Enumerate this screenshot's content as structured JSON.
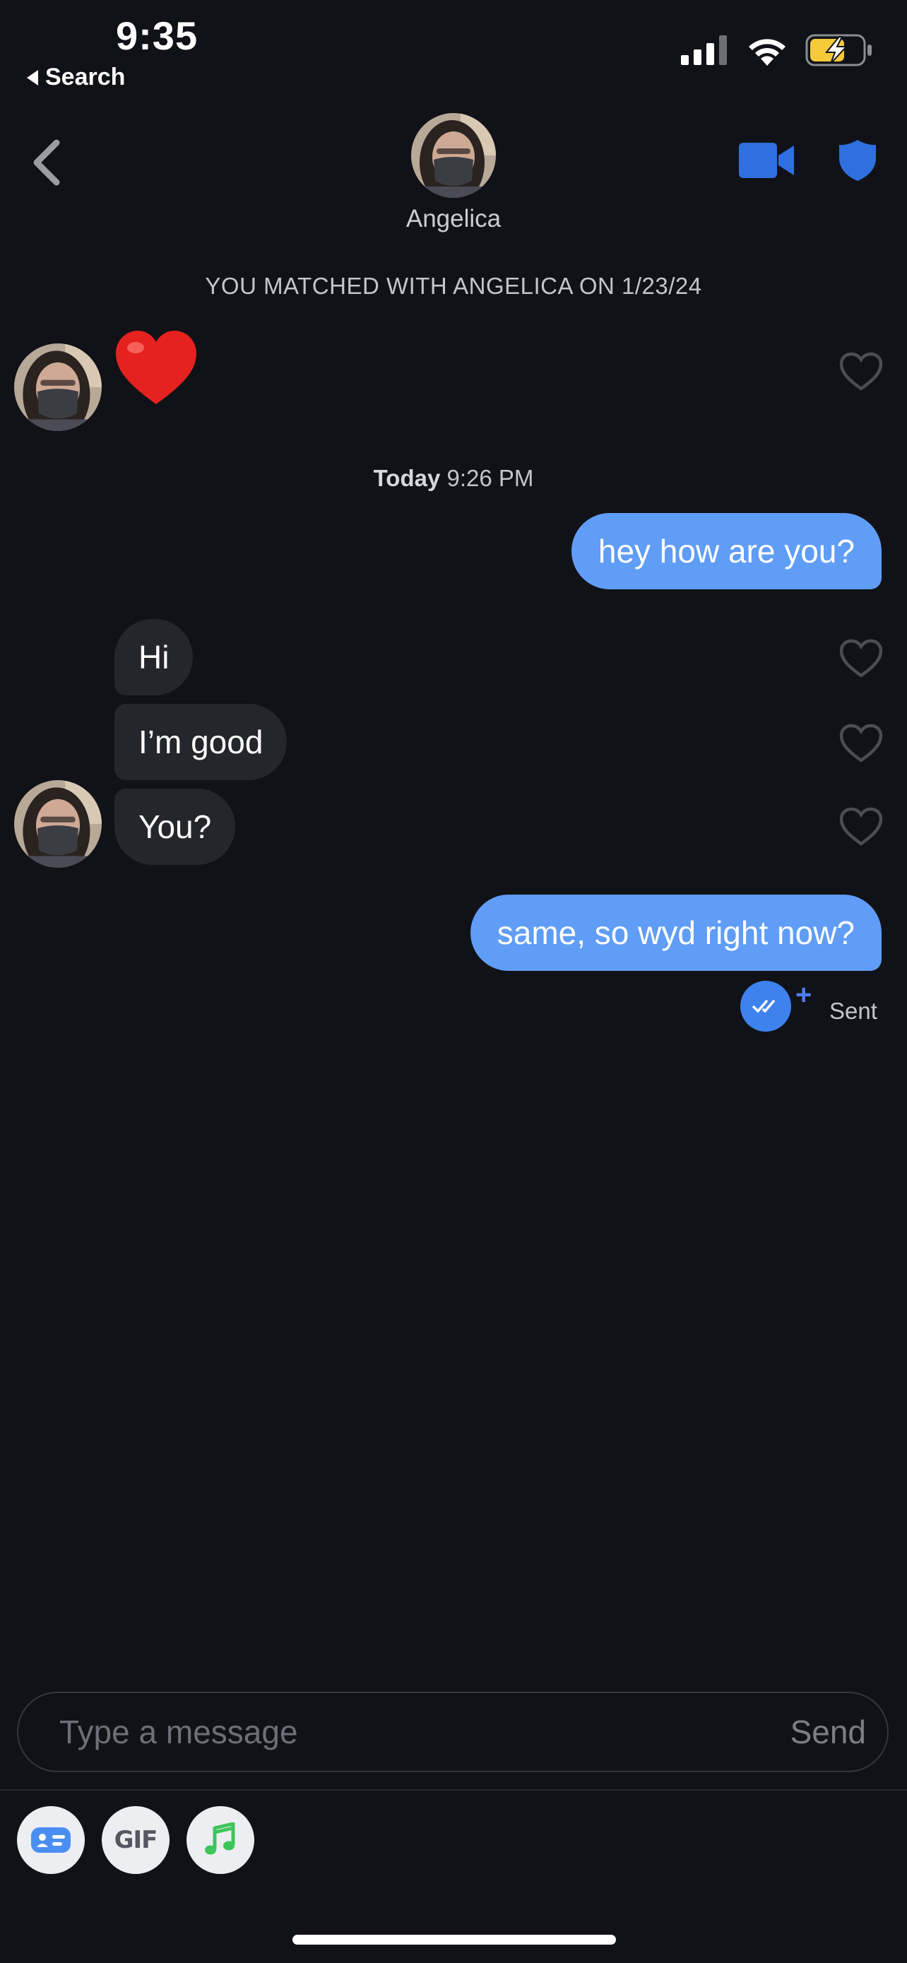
{
  "status_bar": {
    "time": "9:35",
    "back_app_label": "Search",
    "icons": [
      "cellular-signal-icon",
      "wifi-icon",
      "battery-charging-icon"
    ]
  },
  "header": {
    "match_name": "Angelica",
    "icons": [
      "chevron-left-icon",
      "video-camera-icon",
      "shield-icon"
    ]
  },
  "match_notice": "YOU MATCHED WITH ANGELICA ON 1/23/24",
  "thread": {
    "first_message_emoji": "❤️",
    "timestamp_day": "Today",
    "timestamp_time": " 9:26 PM",
    "messages": [
      {
        "from": "me",
        "text": "hey how are you?"
      },
      {
        "from": "them",
        "text": "Hi"
      },
      {
        "from": "them",
        "text": "I’m good"
      },
      {
        "from": "them",
        "text": "You?"
      },
      {
        "from": "me",
        "text": "same, so wyd right now?"
      }
    ],
    "read_status": "Sent"
  },
  "composer": {
    "placeholder": "Type a message",
    "send_label": "Send"
  },
  "toolbar": {
    "gif_label": "GIF",
    "icons": [
      "contact-card-icon",
      "gif-icon",
      "music-note-icon"
    ]
  },
  "colors": {
    "background": "#111217",
    "outgoing_bubble": "#5f9df7",
    "incoming_bubble": "#24262c",
    "accent_blue": "#2f6fe0"
  }
}
